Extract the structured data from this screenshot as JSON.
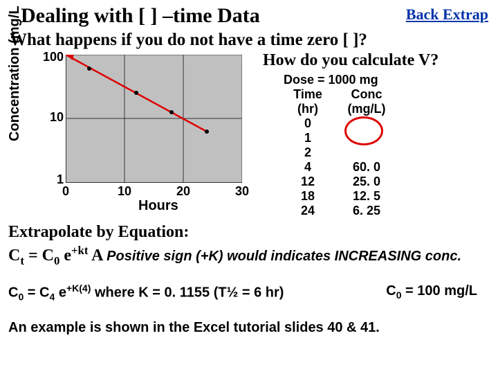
{
  "title": "Dealing with [ ] –time Data",
  "back": "Back Extrap",
  "q1": "What happens if you do not have a time zero [ ]?",
  "q2": "How do you calculate V?",
  "ylabel": "Concentration (mg/L",
  "xlabel": "Hours",
  "yticks": {
    "t100": "100",
    "t10": "10",
    "t1": "1"
  },
  "xticks": {
    "x0": "0",
    "x10": "10",
    "x20": "20",
    "x30": "30"
  },
  "dose": "Dose = 1000 mg",
  "table": {
    "time": {
      "h1": "Time",
      "h2": "(hr)",
      "r0": "0",
      "r1": "1",
      "r2": "2",
      "r3": "4",
      "r4": "12",
      "r5": "18",
      "r6": "24"
    },
    "conc": {
      "h1": "Conc",
      "h2": "(mg/L)",
      "r0": "",
      "r1": "",
      "r2": "",
      "r3": "60. 0",
      "r4": "25. 0",
      "r5": "12. 5",
      "r6": "6. 25"
    }
  },
  "eq1a": "Extrapolate by Equation:",
  "eq1b_pre": "C",
  "eq1b_t": "t",
  "eq1b_mid": " = C",
  "eq1b_0": "0",
  "eq1b_e": " e",
  "eq1b_exp": "+kt",
  "eq1b_gap": "   A ",
  "eq1b_note": "Positive sign (+K) would indicates INCREASING conc.",
  "eq2_pre": "C",
  "eq2_0": "0",
  "eq2_mid": " = C",
  "eq2_4": "4",
  "eq2_e": " e",
  "eq2_exp": "+K(4)",
  "eq2_where": " where K = 0. 1155 (T½ = 6 hr)",
  "eq2_result_pre": "C",
  "eq2_result_0": "0",
  "eq2_result": " = 100 mg/L",
  "eq3": "An example is shown in the Excel tutorial slides 40 & 41.",
  "chart_data": {
    "type": "line",
    "title": "",
    "xlabel": "Hours",
    "ylabel": "Concentration (mg/L)",
    "x": [
      4,
      12,
      18,
      24
    ],
    "y": [
      60.0,
      25.0,
      12.5,
      6.25
    ],
    "xlim": [
      0,
      30
    ],
    "ylim": [
      1,
      100
    ],
    "yscale": "log",
    "annotations": [
      "extrapolated back to t=0 at 100 mg/L (red line)"
    ]
  }
}
